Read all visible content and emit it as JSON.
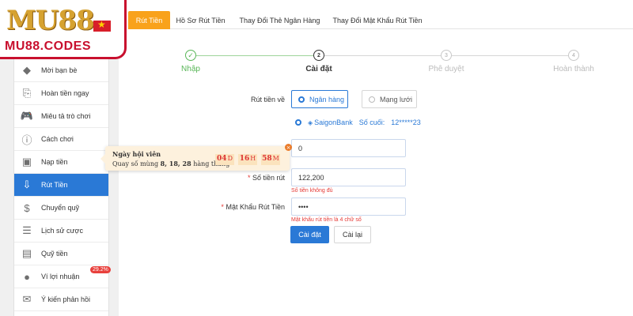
{
  "brand": {
    "mark": "MU",
    "mark_suffix": "88",
    "site": "MU88.CODES",
    "accent": "#c8102e"
  },
  "tabs": [
    {
      "label": "Rút Tiền",
      "active": true
    },
    {
      "label": "Hồ Sơ Rút Tiền"
    },
    {
      "label": "Thay Đổi Thẻ Ngân Hàng"
    },
    {
      "label": "Thay Đổi Mật Khẩu Rút Tiền"
    }
  ],
  "sidebar": {
    "items": [
      {
        "label": "Mời bạn bè",
        "icon": "diamond-icon"
      },
      {
        "label": "Hoàn tiền ngay",
        "icon": "refund-icon"
      },
      {
        "label": "Miêu tả trò chơi",
        "icon": "gamepad-icon"
      },
      {
        "label": "Cách chơi",
        "icon": "info-icon"
      },
      {
        "label": "Nạp tiền",
        "icon": "wallet-icon"
      },
      {
        "label": "Rút Tiền",
        "icon": "withdraw-icon",
        "active": true
      },
      {
        "label": "Chuyển quỹ",
        "icon": "transfer-icon"
      },
      {
        "label": "Lịch sử cược",
        "icon": "history-icon"
      },
      {
        "label": "Quỹ tiền",
        "icon": "fund-icon"
      },
      {
        "label": "Ví lợi nhuận",
        "icon": "piggy-bank-icon",
        "badge": "29.2%"
      },
      {
        "label": "Ý kiến phản hồi",
        "icon": "feedback-icon"
      }
    ],
    "active_color": "#2a79d6"
  },
  "steps": [
    {
      "label": "Nhập",
      "marker": "✓",
      "state": "done"
    },
    {
      "label": "Cài đặt",
      "marker": "2",
      "state": "current"
    },
    {
      "label": "Phê duyệt",
      "marker": "3",
      "state": "pending"
    },
    {
      "label": "Hoàn thành",
      "marker": "4",
      "state": "pending"
    }
  ],
  "form": {
    "method_label": "Rút tiền về",
    "method_options": [
      {
        "label": "Ngân hàng",
        "selected": true
      },
      {
        "label": "Mạng lưới",
        "selected": false
      }
    ],
    "bank": {
      "name": "SaigonBank",
      "last_digits_label": "Số cuối:",
      "last_digits": "12*****23"
    },
    "amount_label": "Số tiền rút",
    "amount_value": "122,200",
    "amount_error": "Số tiền không đủ",
    "top_value": "0",
    "password_label": "Mật Khẩu Rút Tiền",
    "password_value": "••••",
    "password_error": "Mật khẩu rút tiền là 4 chữ số",
    "submit_label": "Cài đặt",
    "reset_label": "Cài lại"
  },
  "promo": {
    "title": "Ngày hội viên",
    "subtitle_prefix": "Quay số mùng",
    "days": "8, 18, 28",
    "subtitle_suffix": "hàng tháng",
    "countdown": [
      {
        "value": "04",
        "unit": "D"
      },
      {
        "value": "16",
        "unit": "H"
      },
      {
        "value": "58",
        "unit": "M"
      }
    ],
    "close": "×"
  }
}
